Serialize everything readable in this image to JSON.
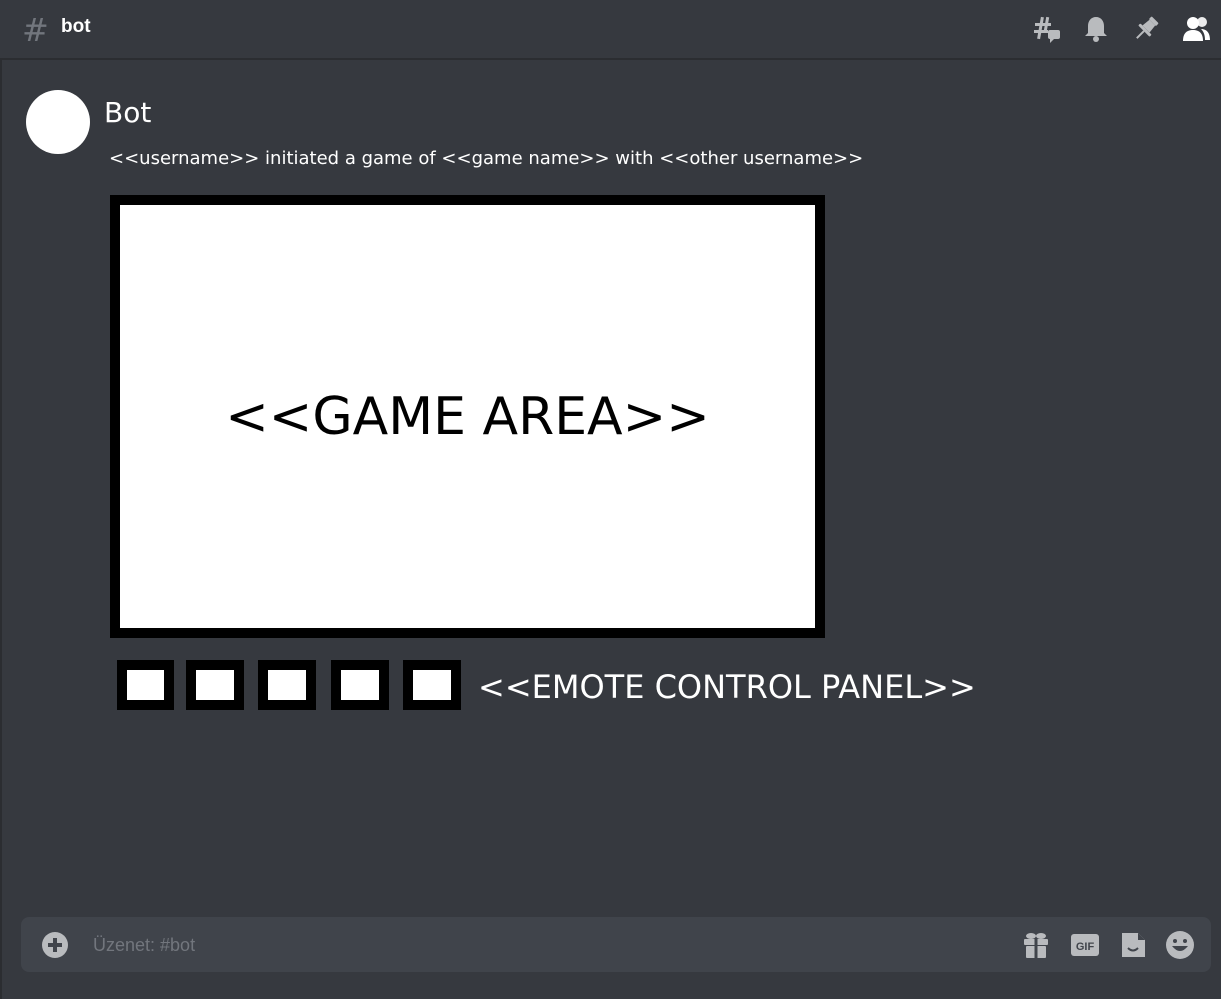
{
  "header": {
    "hash_symbol": "#",
    "channel_name": "bot",
    "icons": [
      "threads-icon",
      "bell-icon",
      "pin-icon",
      "members-icon"
    ]
  },
  "message": {
    "author": "Bot",
    "text": "<<username>> initiated a game of <<game name>> with <<other username>>",
    "game_area_label": "<<GAME AREA>>",
    "emote_panel_label": "<<EMOTE CONTROL PANEL>>",
    "emote_button_count": 5
  },
  "composer": {
    "placeholder": "Üzenet: #bot",
    "icons": [
      "add-icon",
      "gift-icon",
      "gif-icon",
      "sticker-icon",
      "emoji-icon"
    ],
    "gif_label": "GIF"
  },
  "colors": {
    "background": "#36393f",
    "composer": "#40444b",
    "icon": "#b9bbbe"
  }
}
